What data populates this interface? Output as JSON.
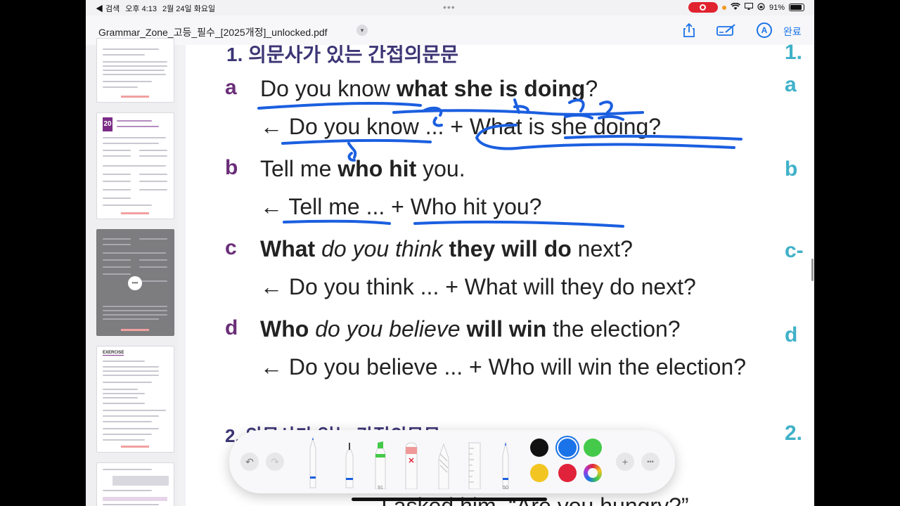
{
  "status_bar": {
    "back_label": "◀ 검색",
    "time": "오후 4:13",
    "date": "2월 24일 화요일",
    "battery": "91%"
  },
  "nav": {
    "title": "Grammar_Zone_고등_필수_[2025개정]_unlocked.pdf",
    "done_label": "완료",
    "markup_icon_letter": "A"
  },
  "page": {
    "section1_heading": "1. 의문사가 있는 간접의문문",
    "section2_heading": "2. 의문사가 없는 간접의문문",
    "examples": [
      {
        "letter": "a",
        "sentence": {
          "p1": "Do you know ",
          "b1": "what she is doing",
          "p2": "?"
        },
        "derivation": "← Do you know ... + What is she doing?"
      },
      {
        "letter": "b",
        "sentence": {
          "p1": "Tell me ",
          "b1": "who hit",
          "p2": " you."
        },
        "derivation": "← Tell me ... + Who hit you?"
      },
      {
        "letter": "c",
        "sentence": {
          "b1": "What ",
          "i1": "do you think ",
          "b2": "they will do",
          "p1": " next?"
        },
        "derivation": "← Do you think ... + What will they do next?"
      },
      {
        "letter": "d",
        "sentence": {
          "b1": "Who ",
          "i1": "do you believe ",
          "b2": "will win",
          "p1": " the election?"
        },
        "derivation": "← Do you believe ... + Who will win the election?"
      }
    ],
    "bottom_partial": "I asked him, “Are you hungry?”"
  },
  "right_margin": {
    "letters": [
      "1.",
      "a",
      "b",
      "c-",
      "d",
      "2."
    ]
  },
  "thumbnails": {
    "badge_number": "20",
    "exercise_label": "EXERCISE"
  },
  "pencil_toolbar": {
    "marker_width_label": "91",
    "pen_width_label": "50",
    "colors": [
      "#111111",
      "#1a73e8",
      "#45c94a",
      "#f2c523",
      "#e0233a"
    ],
    "selected_color": "#1a73e8",
    "add_label": "+",
    "more_label": "•••"
  },
  "annotation_color": "#1b5fe0"
}
